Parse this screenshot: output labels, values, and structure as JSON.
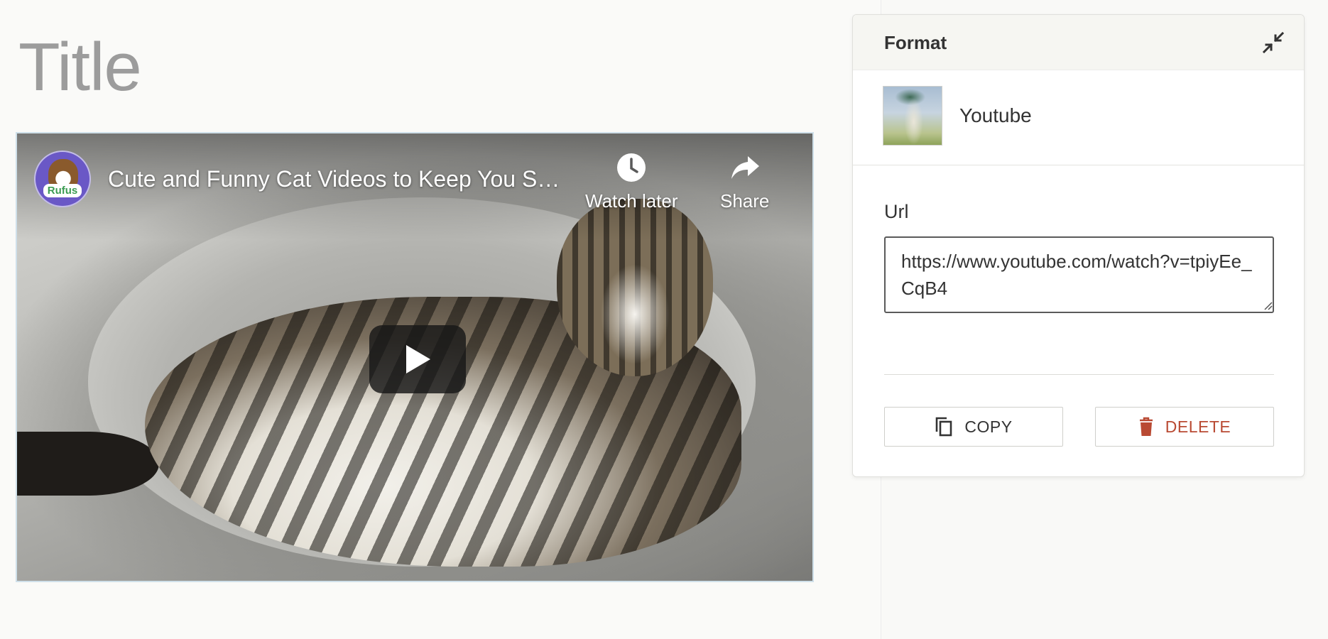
{
  "page": {
    "title": "Title"
  },
  "video": {
    "title": "Cute and Funny Cat Videos to Keep You Smiling",
    "channel_avatar_label": "Rufus",
    "watch_later_label": "Watch later",
    "share_label": "Share",
    "icons": {
      "watch_later": "clock-icon",
      "share": "share-arrow-icon",
      "play": "play-icon"
    }
  },
  "panel": {
    "title": "Format",
    "collapse_icon": "collapse-arrows-icon",
    "source": {
      "name": "Youtube",
      "thumbnail": "youtube-thumbnail"
    },
    "url": {
      "label": "Url",
      "value": "https://www.youtube.com/watch?v=tpiyEe_CqB4"
    },
    "copy_button": {
      "label": "COPY",
      "icon": "copy-icon"
    },
    "delete_button": {
      "label": "DELETE",
      "icon": "trash-icon"
    }
  },
  "colors": {
    "delete_accent": "#b94a33",
    "title_gray": "#9c9c9c",
    "video_border": "#cfe0ea",
    "avatar_purple": "#6a58c6"
  }
}
